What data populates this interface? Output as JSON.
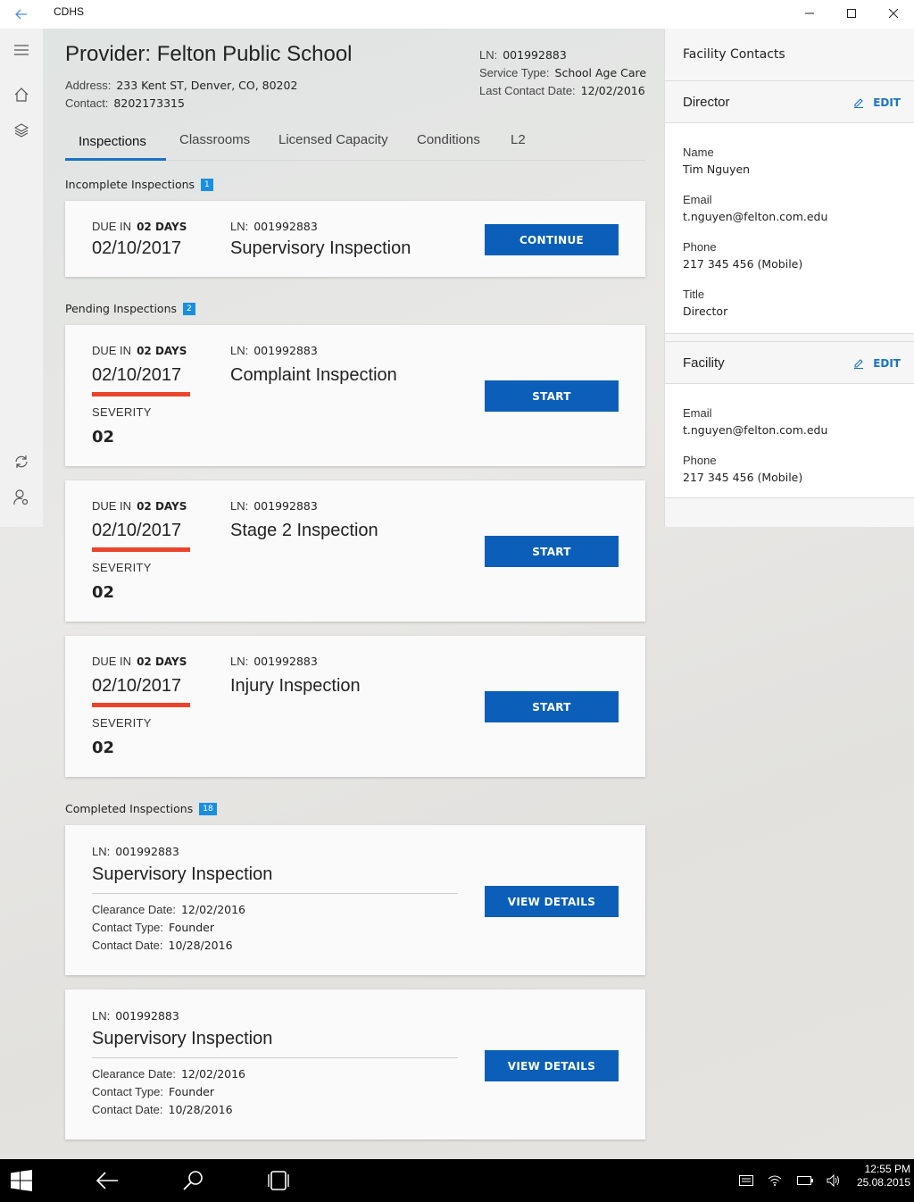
{
  "window": {
    "title": "CDHS"
  },
  "provider": {
    "title": "Provider: Felton Public School",
    "address_label": "Address:",
    "address": "233 Kent ST, Denver, CO, 80202",
    "contact_label": "Contact:",
    "contact": "8202173315",
    "ln_label": "LN:",
    "ln": "001992883",
    "service_type_label": "Service Type:",
    "service_type": "School Age Care",
    "last_contact_label": "Last Contact Date:",
    "last_contact": "12/02/2016"
  },
  "tabs": [
    {
      "label": "Inspections",
      "active": true
    },
    {
      "label": "Classrooms"
    },
    {
      "label": "Licensed Capacity"
    },
    {
      "label": "Conditions"
    },
    {
      "label": "L2"
    }
  ],
  "sections": {
    "incomplete": {
      "label": "Incomplete Inspections",
      "count": "1"
    },
    "pending": {
      "label": "Pending Inspections",
      "count": "2"
    },
    "completed": {
      "label": "Completed Inspections",
      "count": "18"
    }
  },
  "incomplete": [
    {
      "due_label": "DUE IN",
      "due_days": "02 DAYS",
      "due_date": "02/10/2017",
      "ln_label": "LN:",
      "ln": "001992883",
      "name": "Supervisory Inspection",
      "action": "CONTINUE"
    }
  ],
  "pending": [
    {
      "due_label": "DUE IN",
      "due_days": "02 DAYS",
      "due_date": "02/10/2017",
      "severity_label": "SEVERITY",
      "severity": "02",
      "ln_label": "LN:",
      "ln": "001992883",
      "name": "Complaint Inspection",
      "action": "START"
    },
    {
      "due_label": "DUE IN",
      "due_days": "02 DAYS",
      "due_date": "02/10/2017",
      "severity_label": "SEVERITY",
      "severity": "02",
      "ln_label": "LN:",
      "ln": "001992883",
      "name": "Stage 2 Inspection",
      "action": "START"
    },
    {
      "due_label": "DUE IN",
      "due_days": "02 DAYS",
      "due_date": "02/10/2017",
      "severity_label": "SEVERITY",
      "severity": "02",
      "ln_label": "LN:",
      "ln": "001992883",
      "name": "Injury Inspection",
      "action": "START"
    }
  ],
  "completed": [
    {
      "ln_label": "LN:",
      "ln": "001992883",
      "name": "Supervisory Inspection",
      "clearance_label": "Clearance Date:",
      "clearance": "12/02/2016",
      "contact_type_label": "Contact Type:",
      "contact_type": "Founder",
      "contact_date_label": "Contact Date:",
      "contact_date": "10/28/2016",
      "action": "VIEW DETAILS"
    },
    {
      "ln_label": "LN:",
      "ln": "001992883",
      "name": "Supervisory Inspection",
      "clearance_label": "Clearance Date:",
      "clearance": "12/02/2016",
      "contact_type_label": "Contact Type:",
      "contact_type": "Founder",
      "contact_date_label": "Contact Date:",
      "contact_date": "10/28/2016",
      "action": "VIEW DETAILS"
    }
  ],
  "facility_contacts": {
    "title": "Facility Contacts",
    "edit_label": "EDIT",
    "director": {
      "heading": "Director",
      "name_label": "Name",
      "name": "Tim Nguyen",
      "email_label": "Email",
      "email": "t.nguyen@felton.com.edu",
      "phone_label": "Phone",
      "phone": "217 345 456 (Mobile)",
      "title_label": "Title",
      "title": "Director"
    },
    "facility": {
      "heading": "Facility",
      "email_label": "Email",
      "email": "t.nguyen@felton.com.edu",
      "phone_label": "Phone",
      "phone": "217 345 456 (Mobile)"
    }
  },
  "taskbar": {
    "time": "12:55 PM",
    "date": "25.08.2015"
  },
  "colors": {
    "accent": "#0b5fb8",
    "severity": "#e8452c",
    "badge": "#1a8fe0"
  },
  "icons": [
    "back-arrow-icon",
    "hamburger-icon",
    "home-icon",
    "layers-icon",
    "sync-icon",
    "user-settings-icon",
    "edit-pencil-icon",
    "windows-logo-icon",
    "search-icon",
    "task-view-icon",
    "notification-icon",
    "wifi-icon",
    "battery-icon",
    "volume-icon"
  ]
}
